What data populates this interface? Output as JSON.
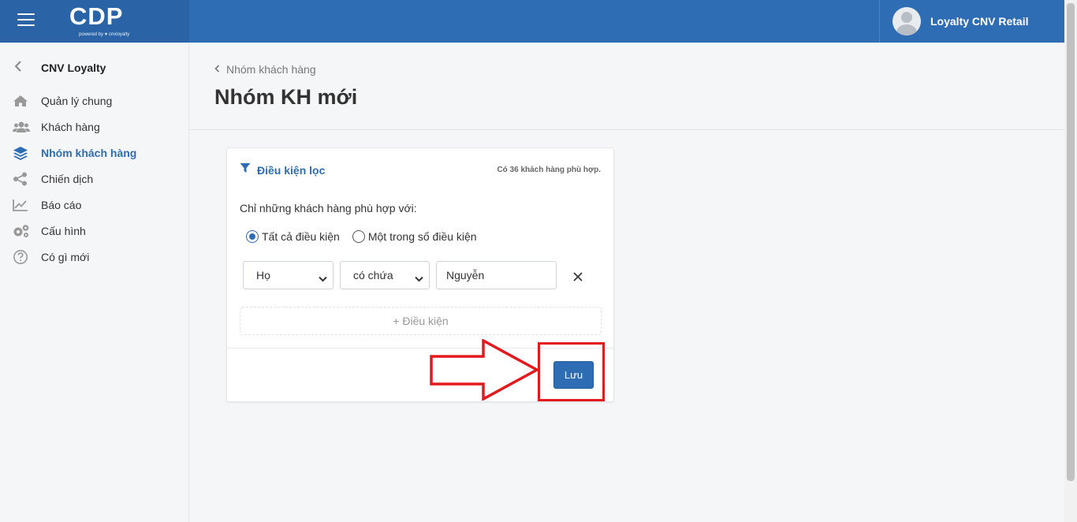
{
  "topbar": {
    "logo_main": "CDP",
    "logo_sub": "powered by ♥ cnvloyalty",
    "user_name": "Loyalty CNV Retail"
  },
  "sidebar": {
    "back_title": "CNV Loyalty",
    "items": [
      {
        "label": "Quản lý chung",
        "icon": "home-icon",
        "active": false
      },
      {
        "label": "Khách hàng",
        "icon": "users-icon",
        "active": false
      },
      {
        "label": "Nhóm khách hàng",
        "icon": "layers-icon",
        "active": true
      },
      {
        "label": "Chiến dịch",
        "icon": "share-icon",
        "active": false
      },
      {
        "label": "Báo cáo",
        "icon": "chart-line-icon",
        "active": false
      },
      {
        "label": "Cấu hình",
        "icon": "gears-icon",
        "active": false
      },
      {
        "label": "Có gì mới",
        "icon": "question-circle-icon",
        "active": false
      }
    ]
  },
  "header": {
    "breadcrumb": "Nhóm khách hàng",
    "title": "Nhóm KH mới"
  },
  "filter": {
    "heading": "Điều kiện lọc",
    "match_count": "Có 36 khách hàng phù hợp.",
    "match_text": "Chỉ những khách hàng phù hợp với:",
    "radio_all": "Tất cả điều kiện",
    "radio_any": "Một trong số điều kiện",
    "selected_radio": "all",
    "condition": {
      "field": "Họ",
      "operator": "có chứa",
      "value": "Nguyễn"
    },
    "add_condition": "+ Điều kiện",
    "save_label": "Lưu"
  },
  "colors": {
    "brand": "#2e6db4",
    "annotation": "#e3191d"
  }
}
